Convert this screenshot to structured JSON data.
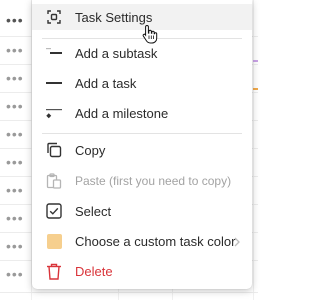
{
  "menu": {
    "items": [
      {
        "id": "task-settings",
        "label": "Task Settings",
        "icon": "settings-frame-icon"
      },
      {
        "id": "add-subtask",
        "label": "Add a subtask",
        "icon": "subtask-icon"
      },
      {
        "id": "add-task",
        "label": "Add a task",
        "icon": "task-line-icon"
      },
      {
        "id": "add-milestone",
        "label": "Add a milestone",
        "icon": "milestone-icon"
      },
      {
        "id": "copy",
        "label": "Copy",
        "icon": "copy-icon"
      },
      {
        "id": "paste",
        "label": "Paste (first you need to copy)",
        "icon": "paste-icon",
        "disabled": true
      },
      {
        "id": "select",
        "label": "Select",
        "icon": "checkbox-icon"
      },
      {
        "id": "custom-color",
        "label": "Choose a custom task color",
        "icon": "color-swatch-icon",
        "has_submenu": true
      },
      {
        "id": "delete",
        "label": "Delete",
        "icon": "trash-icon",
        "danger": true
      }
    ]
  },
  "colors": {
    "swatch": "#f6cf8e",
    "danger": "#d9343a",
    "hover_bg": "#f2f2f2"
  }
}
